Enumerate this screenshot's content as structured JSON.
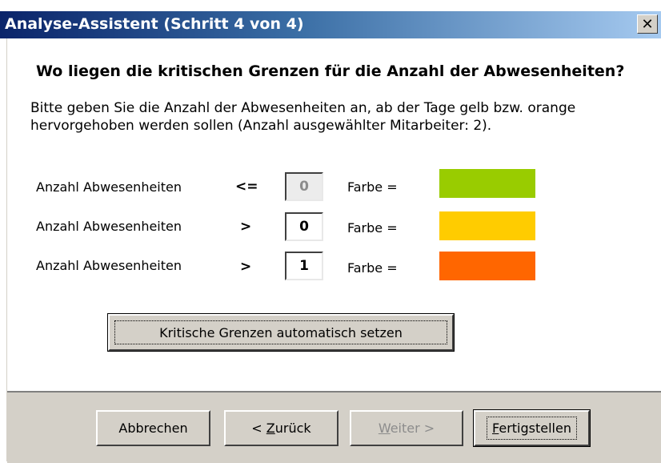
{
  "window": {
    "title": "Analyse-Assistent (Schritt 4 von 4)",
    "close_symbol": "✕"
  },
  "main": {
    "heading": "Wo liegen die kritischen Grenzen für die Anzahl der Abwesenheiten?",
    "intro": "Bitte geben Sie die Anzahl der Abwesenheiten an, ab der Tage gelb bzw. orange hervorgehoben werden sollen (Anzahl ausgewählter Mitarbeiter: 2).",
    "rows": [
      {
        "label": "Anzahl Abwesenheiten",
        "operator": "<=",
        "value": "0",
        "farbe_label": "Farbe =",
        "color": "#99cc00",
        "disabled": true
      },
      {
        "label": "Anzahl Abwesenheiten",
        "operator": ">",
        "value": "0",
        "farbe_label": "Farbe =",
        "color": "#ffcc00",
        "disabled": false
      },
      {
        "label": "Anzahl Abwesenheiten",
        "operator": ">",
        "value": "1",
        "farbe_label": "Farbe =",
        "color": "#ff6600",
        "disabled": false
      }
    ],
    "auto_button": "Kritische Grenzen automatisch setzen"
  },
  "footer": {
    "cancel": "Abbrechen",
    "back_prefix": "< ",
    "back_mnemonic": "Z",
    "back_rest": "urück",
    "next_mnemonic": "W",
    "next_rest": "eiter >",
    "finish_mnemonic": "F",
    "finish_rest": "ertigstellen"
  }
}
